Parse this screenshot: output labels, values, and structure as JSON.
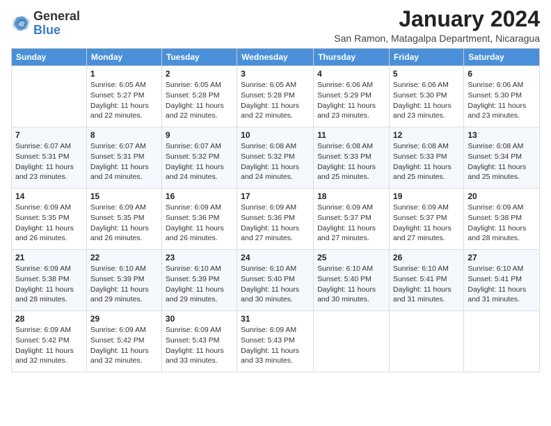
{
  "header": {
    "logo_general": "General",
    "logo_blue": "Blue",
    "month_title": "January 2024",
    "location": "San Ramon, Matagalpa Department, Nicaragua"
  },
  "weekdays": [
    "Sunday",
    "Monday",
    "Tuesday",
    "Wednesday",
    "Thursday",
    "Friday",
    "Saturday"
  ],
  "weeks": [
    [
      {
        "day": "",
        "sunrise": "",
        "sunset": "",
        "daylight": ""
      },
      {
        "day": "1",
        "sunrise": "Sunrise: 6:05 AM",
        "sunset": "Sunset: 5:27 PM",
        "daylight": "Daylight: 11 hours and 22 minutes."
      },
      {
        "day": "2",
        "sunrise": "Sunrise: 6:05 AM",
        "sunset": "Sunset: 5:28 PM",
        "daylight": "Daylight: 11 hours and 22 minutes."
      },
      {
        "day": "3",
        "sunrise": "Sunrise: 6:05 AM",
        "sunset": "Sunset: 5:28 PM",
        "daylight": "Daylight: 11 hours and 22 minutes."
      },
      {
        "day": "4",
        "sunrise": "Sunrise: 6:06 AM",
        "sunset": "Sunset: 5:29 PM",
        "daylight": "Daylight: 11 hours and 23 minutes."
      },
      {
        "day": "5",
        "sunrise": "Sunrise: 6:06 AM",
        "sunset": "Sunset: 5:30 PM",
        "daylight": "Daylight: 11 hours and 23 minutes."
      },
      {
        "day": "6",
        "sunrise": "Sunrise: 6:06 AM",
        "sunset": "Sunset: 5:30 PM",
        "daylight": "Daylight: 11 hours and 23 minutes."
      }
    ],
    [
      {
        "day": "7",
        "sunrise": "Sunrise: 6:07 AM",
        "sunset": "Sunset: 5:31 PM",
        "daylight": "Daylight: 11 hours and 23 minutes."
      },
      {
        "day": "8",
        "sunrise": "Sunrise: 6:07 AM",
        "sunset": "Sunset: 5:31 PM",
        "daylight": "Daylight: 11 hours and 24 minutes."
      },
      {
        "day": "9",
        "sunrise": "Sunrise: 6:07 AM",
        "sunset": "Sunset: 5:32 PM",
        "daylight": "Daylight: 11 hours and 24 minutes."
      },
      {
        "day": "10",
        "sunrise": "Sunrise: 6:08 AM",
        "sunset": "Sunset: 5:32 PM",
        "daylight": "Daylight: 11 hours and 24 minutes."
      },
      {
        "day": "11",
        "sunrise": "Sunrise: 6:08 AM",
        "sunset": "Sunset: 5:33 PM",
        "daylight": "Daylight: 11 hours and 25 minutes."
      },
      {
        "day": "12",
        "sunrise": "Sunrise: 6:08 AM",
        "sunset": "Sunset: 5:33 PM",
        "daylight": "Daylight: 11 hours and 25 minutes."
      },
      {
        "day": "13",
        "sunrise": "Sunrise: 6:08 AM",
        "sunset": "Sunset: 5:34 PM",
        "daylight": "Daylight: 11 hours and 25 minutes."
      }
    ],
    [
      {
        "day": "14",
        "sunrise": "Sunrise: 6:09 AM",
        "sunset": "Sunset: 5:35 PM",
        "daylight": "Daylight: 11 hours and 26 minutes."
      },
      {
        "day": "15",
        "sunrise": "Sunrise: 6:09 AM",
        "sunset": "Sunset: 5:35 PM",
        "daylight": "Daylight: 11 hours and 26 minutes."
      },
      {
        "day": "16",
        "sunrise": "Sunrise: 6:09 AM",
        "sunset": "Sunset: 5:36 PM",
        "daylight": "Daylight: 11 hours and 26 minutes."
      },
      {
        "day": "17",
        "sunrise": "Sunrise: 6:09 AM",
        "sunset": "Sunset: 5:36 PM",
        "daylight": "Daylight: 11 hours and 27 minutes."
      },
      {
        "day": "18",
        "sunrise": "Sunrise: 6:09 AM",
        "sunset": "Sunset: 5:37 PM",
        "daylight": "Daylight: 11 hours and 27 minutes."
      },
      {
        "day": "19",
        "sunrise": "Sunrise: 6:09 AM",
        "sunset": "Sunset: 5:37 PM",
        "daylight": "Daylight: 11 hours and 27 minutes."
      },
      {
        "day": "20",
        "sunrise": "Sunrise: 6:09 AM",
        "sunset": "Sunset: 5:38 PM",
        "daylight": "Daylight: 11 hours and 28 minutes."
      }
    ],
    [
      {
        "day": "21",
        "sunrise": "Sunrise: 6:09 AM",
        "sunset": "Sunset: 5:38 PM",
        "daylight": "Daylight: 11 hours and 28 minutes."
      },
      {
        "day": "22",
        "sunrise": "Sunrise: 6:10 AM",
        "sunset": "Sunset: 5:39 PM",
        "daylight": "Daylight: 11 hours and 29 minutes."
      },
      {
        "day": "23",
        "sunrise": "Sunrise: 6:10 AM",
        "sunset": "Sunset: 5:39 PM",
        "daylight": "Daylight: 11 hours and 29 minutes."
      },
      {
        "day": "24",
        "sunrise": "Sunrise: 6:10 AM",
        "sunset": "Sunset: 5:40 PM",
        "daylight": "Daylight: 11 hours and 30 minutes."
      },
      {
        "day": "25",
        "sunrise": "Sunrise: 6:10 AM",
        "sunset": "Sunset: 5:40 PM",
        "daylight": "Daylight: 11 hours and 30 minutes."
      },
      {
        "day": "26",
        "sunrise": "Sunrise: 6:10 AM",
        "sunset": "Sunset: 5:41 PM",
        "daylight": "Daylight: 11 hours and 31 minutes."
      },
      {
        "day": "27",
        "sunrise": "Sunrise: 6:10 AM",
        "sunset": "Sunset: 5:41 PM",
        "daylight": "Daylight: 11 hours and 31 minutes."
      }
    ],
    [
      {
        "day": "28",
        "sunrise": "Sunrise: 6:09 AM",
        "sunset": "Sunset: 5:42 PM",
        "daylight": "Daylight: 11 hours and 32 minutes."
      },
      {
        "day": "29",
        "sunrise": "Sunrise: 6:09 AM",
        "sunset": "Sunset: 5:42 PM",
        "daylight": "Daylight: 11 hours and 32 minutes."
      },
      {
        "day": "30",
        "sunrise": "Sunrise: 6:09 AM",
        "sunset": "Sunset: 5:43 PM",
        "daylight": "Daylight: 11 hours and 33 minutes."
      },
      {
        "day": "31",
        "sunrise": "Sunrise: 6:09 AM",
        "sunset": "Sunset: 5:43 PM",
        "daylight": "Daylight: 11 hours and 33 minutes."
      },
      {
        "day": "",
        "sunrise": "",
        "sunset": "",
        "daylight": ""
      },
      {
        "day": "",
        "sunrise": "",
        "sunset": "",
        "daylight": ""
      },
      {
        "day": "",
        "sunrise": "",
        "sunset": "",
        "daylight": ""
      }
    ]
  ]
}
